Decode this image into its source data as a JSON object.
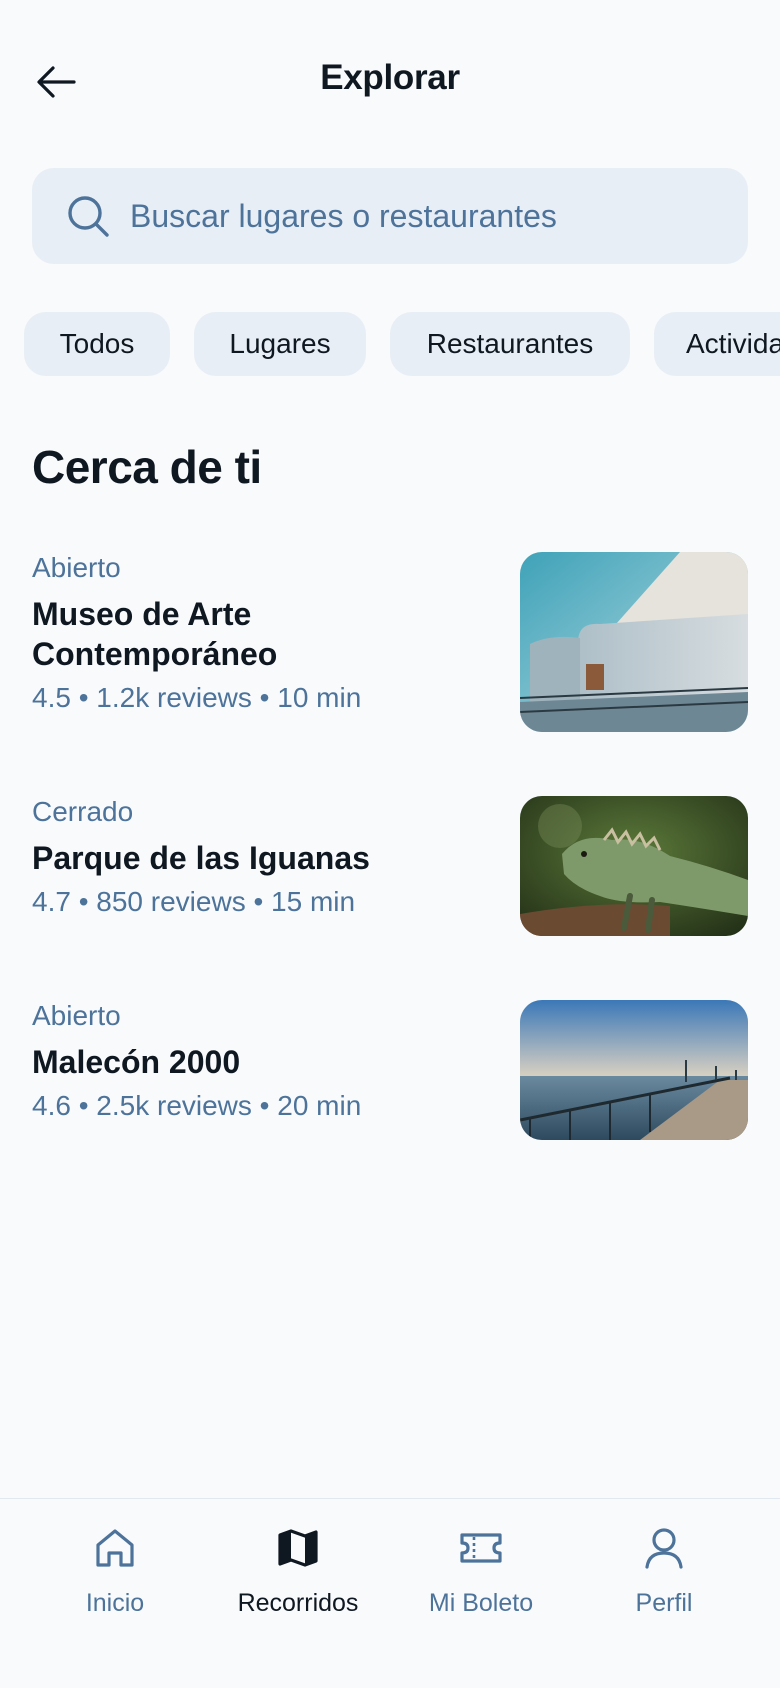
{
  "header": {
    "title": "Explorar"
  },
  "search": {
    "placeholder": "Buscar lugares o restaurantes"
  },
  "filters": [
    "Todos",
    "Lugares",
    "Restaurantes",
    "Actividades"
  ],
  "section": {
    "title": "Cerca de ti"
  },
  "places": [
    {
      "status": "Abierto",
      "name": "Museo de Arte Contemporáneo",
      "meta": "4.5 • 1.2k reviews • 10 min"
    },
    {
      "status": "Cerrado",
      "name": "Parque de las Iguanas",
      "meta": "4.7 • 850 reviews • 15 min"
    },
    {
      "status": "Abierto",
      "name": "Malecón 2000",
      "meta": "4.6 • 2.5k reviews • 20 min"
    }
  ],
  "nav": {
    "items": [
      {
        "label": "Inicio",
        "icon": "home-icon"
      },
      {
        "label": "Recorridos",
        "icon": "map-icon",
        "active": true
      },
      {
        "label": "Mi Boleto",
        "icon": "ticket-icon"
      },
      {
        "label": "Perfil",
        "icon": "user-icon"
      }
    ]
  },
  "colors": {
    "accent": "#4d739a",
    "text": "#0f1720",
    "chip_bg": "#e8eef5",
    "background": "#f8fafc"
  }
}
